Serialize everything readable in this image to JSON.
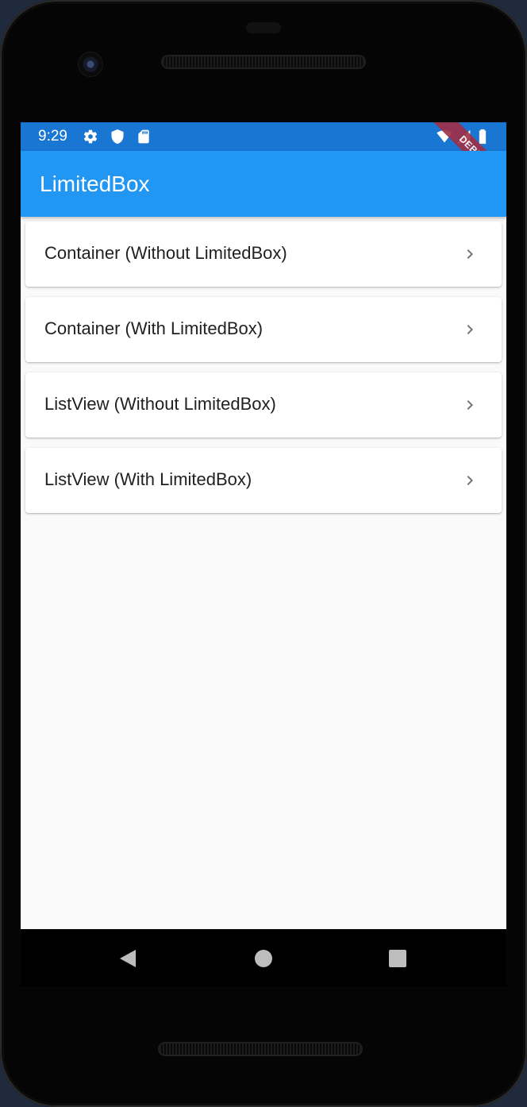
{
  "status_bar": {
    "time": "9:29",
    "icons_left": [
      "gear-icon",
      "shield-icon",
      "sd-card-icon"
    ],
    "icons_right": [
      "wifi-icon",
      "signal-icon",
      "battery-icon"
    ],
    "debug_label": "DEBUG"
  },
  "app_bar": {
    "title": "LimitedBox",
    "color": "#2196f3",
    "status_color": "#1976d2"
  },
  "list": {
    "items": [
      {
        "label": "Container (Without LimitedBox)",
        "trailing_icon": "chevron-right-icon"
      },
      {
        "label": "Container (With LimitedBox)",
        "trailing_icon": "chevron-right-icon"
      },
      {
        "label": "ListView (Without LimitedBox)",
        "trailing_icon": "chevron-right-icon"
      },
      {
        "label": "ListView (With LimitedBox)",
        "trailing_icon": "chevron-right-icon"
      }
    ]
  },
  "nav_bar": {
    "buttons": [
      "back-icon",
      "home-icon",
      "recents-icon"
    ]
  }
}
